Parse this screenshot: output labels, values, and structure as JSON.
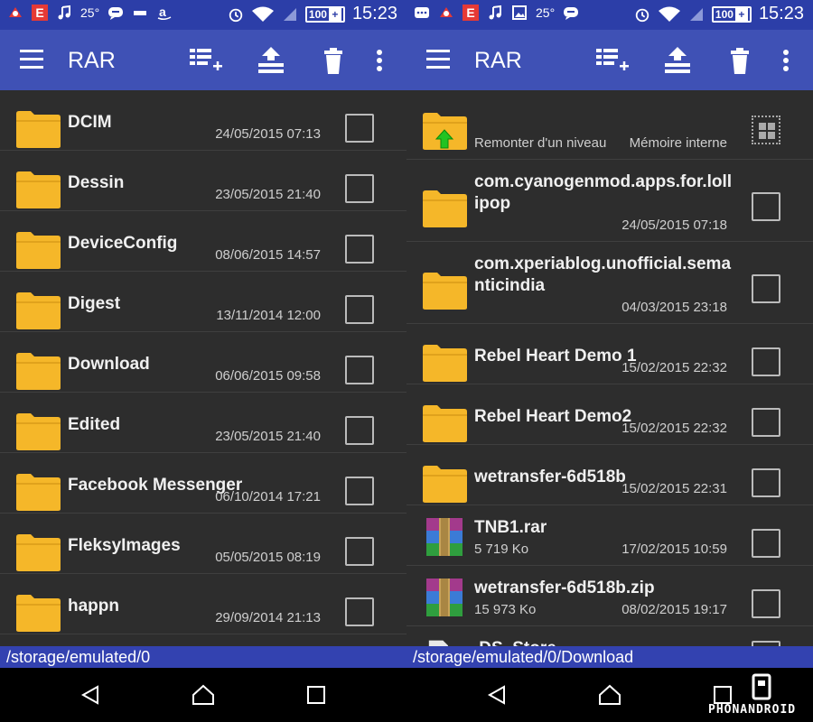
{
  "status": {
    "temperature": "25°",
    "battery": "100",
    "battery_plus": "+",
    "time": "15:23",
    "left_icons": [
      "app-icon",
      "e-icon",
      "music-icon",
      "temperature",
      "message-icon",
      "notification-icon",
      "amazon-icon"
    ],
    "right_panel_icons": [
      "chat-icon",
      "app-icon",
      "e-icon",
      "music-icon",
      "image-icon",
      "temperature",
      "message-icon"
    ]
  },
  "toolbar": {
    "title": "RAR",
    "actions": [
      "add-to-archive-icon",
      "extract-icon",
      "delete-icon",
      "more-vert-icon"
    ]
  },
  "left_list": {
    "path": "/storage/emulated/0",
    "items": [
      {
        "name": "DCIM",
        "date": "24/05/2015 07:13"
      },
      {
        "name": "Dessin",
        "date": "23/05/2015 21:40"
      },
      {
        "name": "DeviceConfig",
        "date": "08/06/2015 14:57"
      },
      {
        "name": "Digest",
        "date": "13/11/2014 12:00"
      },
      {
        "name": "Download",
        "date": "06/06/2015 09:58"
      },
      {
        "name": "Edited",
        "date": "23/05/2015 21:40"
      },
      {
        "name": "Facebook Messenger",
        "date": "06/10/2014 17:21"
      },
      {
        "name": "FleksyImages",
        "date": "05/05/2015 08:19"
      },
      {
        "name": "happn",
        "date": "29/09/2014 21:13"
      }
    ]
  },
  "right_list": {
    "path": "/storage/emulated/0/Download",
    "up_label": "Remonter d'un niveau",
    "storage_label": "Mémoire interne",
    "items": [
      {
        "name": "com.cyanogenmod.apps.for.lollipop",
        "date": "24/05/2015 07:18"
      },
      {
        "name": "com.xperiablog.unofficial.semanticindia",
        "date": "04/03/2015 23:18"
      },
      {
        "name": "Rebel Heart Demo 1",
        "date": "15/02/2015 22:32"
      },
      {
        "name": "Rebel Heart Demo2",
        "date": "15/02/2015 22:32"
      },
      {
        "name": "wetransfer-6d518b",
        "date": "15/02/2015 22:31"
      }
    ],
    "archives": [
      {
        "name": "TNB1.rar",
        "size": "5 719 Ko",
        "date": "17/02/2015 10:59"
      },
      {
        "name": "wetransfer-6d518b.zip",
        "size": "15 973 Ko",
        "date": "08/02/2015 19:17"
      }
    ],
    "partial_item": ".DS_Store"
  },
  "navbar": {
    "buttons": [
      "back-icon",
      "home-icon",
      "recent-apps-icon"
    ]
  },
  "watermark": {
    "text": "PHONANDROID"
  },
  "colors": {
    "statusbar": "#2c3ea8",
    "toolbar": "#3f51b5",
    "background": "#2d2d2d",
    "folder": "#f5b729",
    "pathbar": "#3342b0"
  }
}
